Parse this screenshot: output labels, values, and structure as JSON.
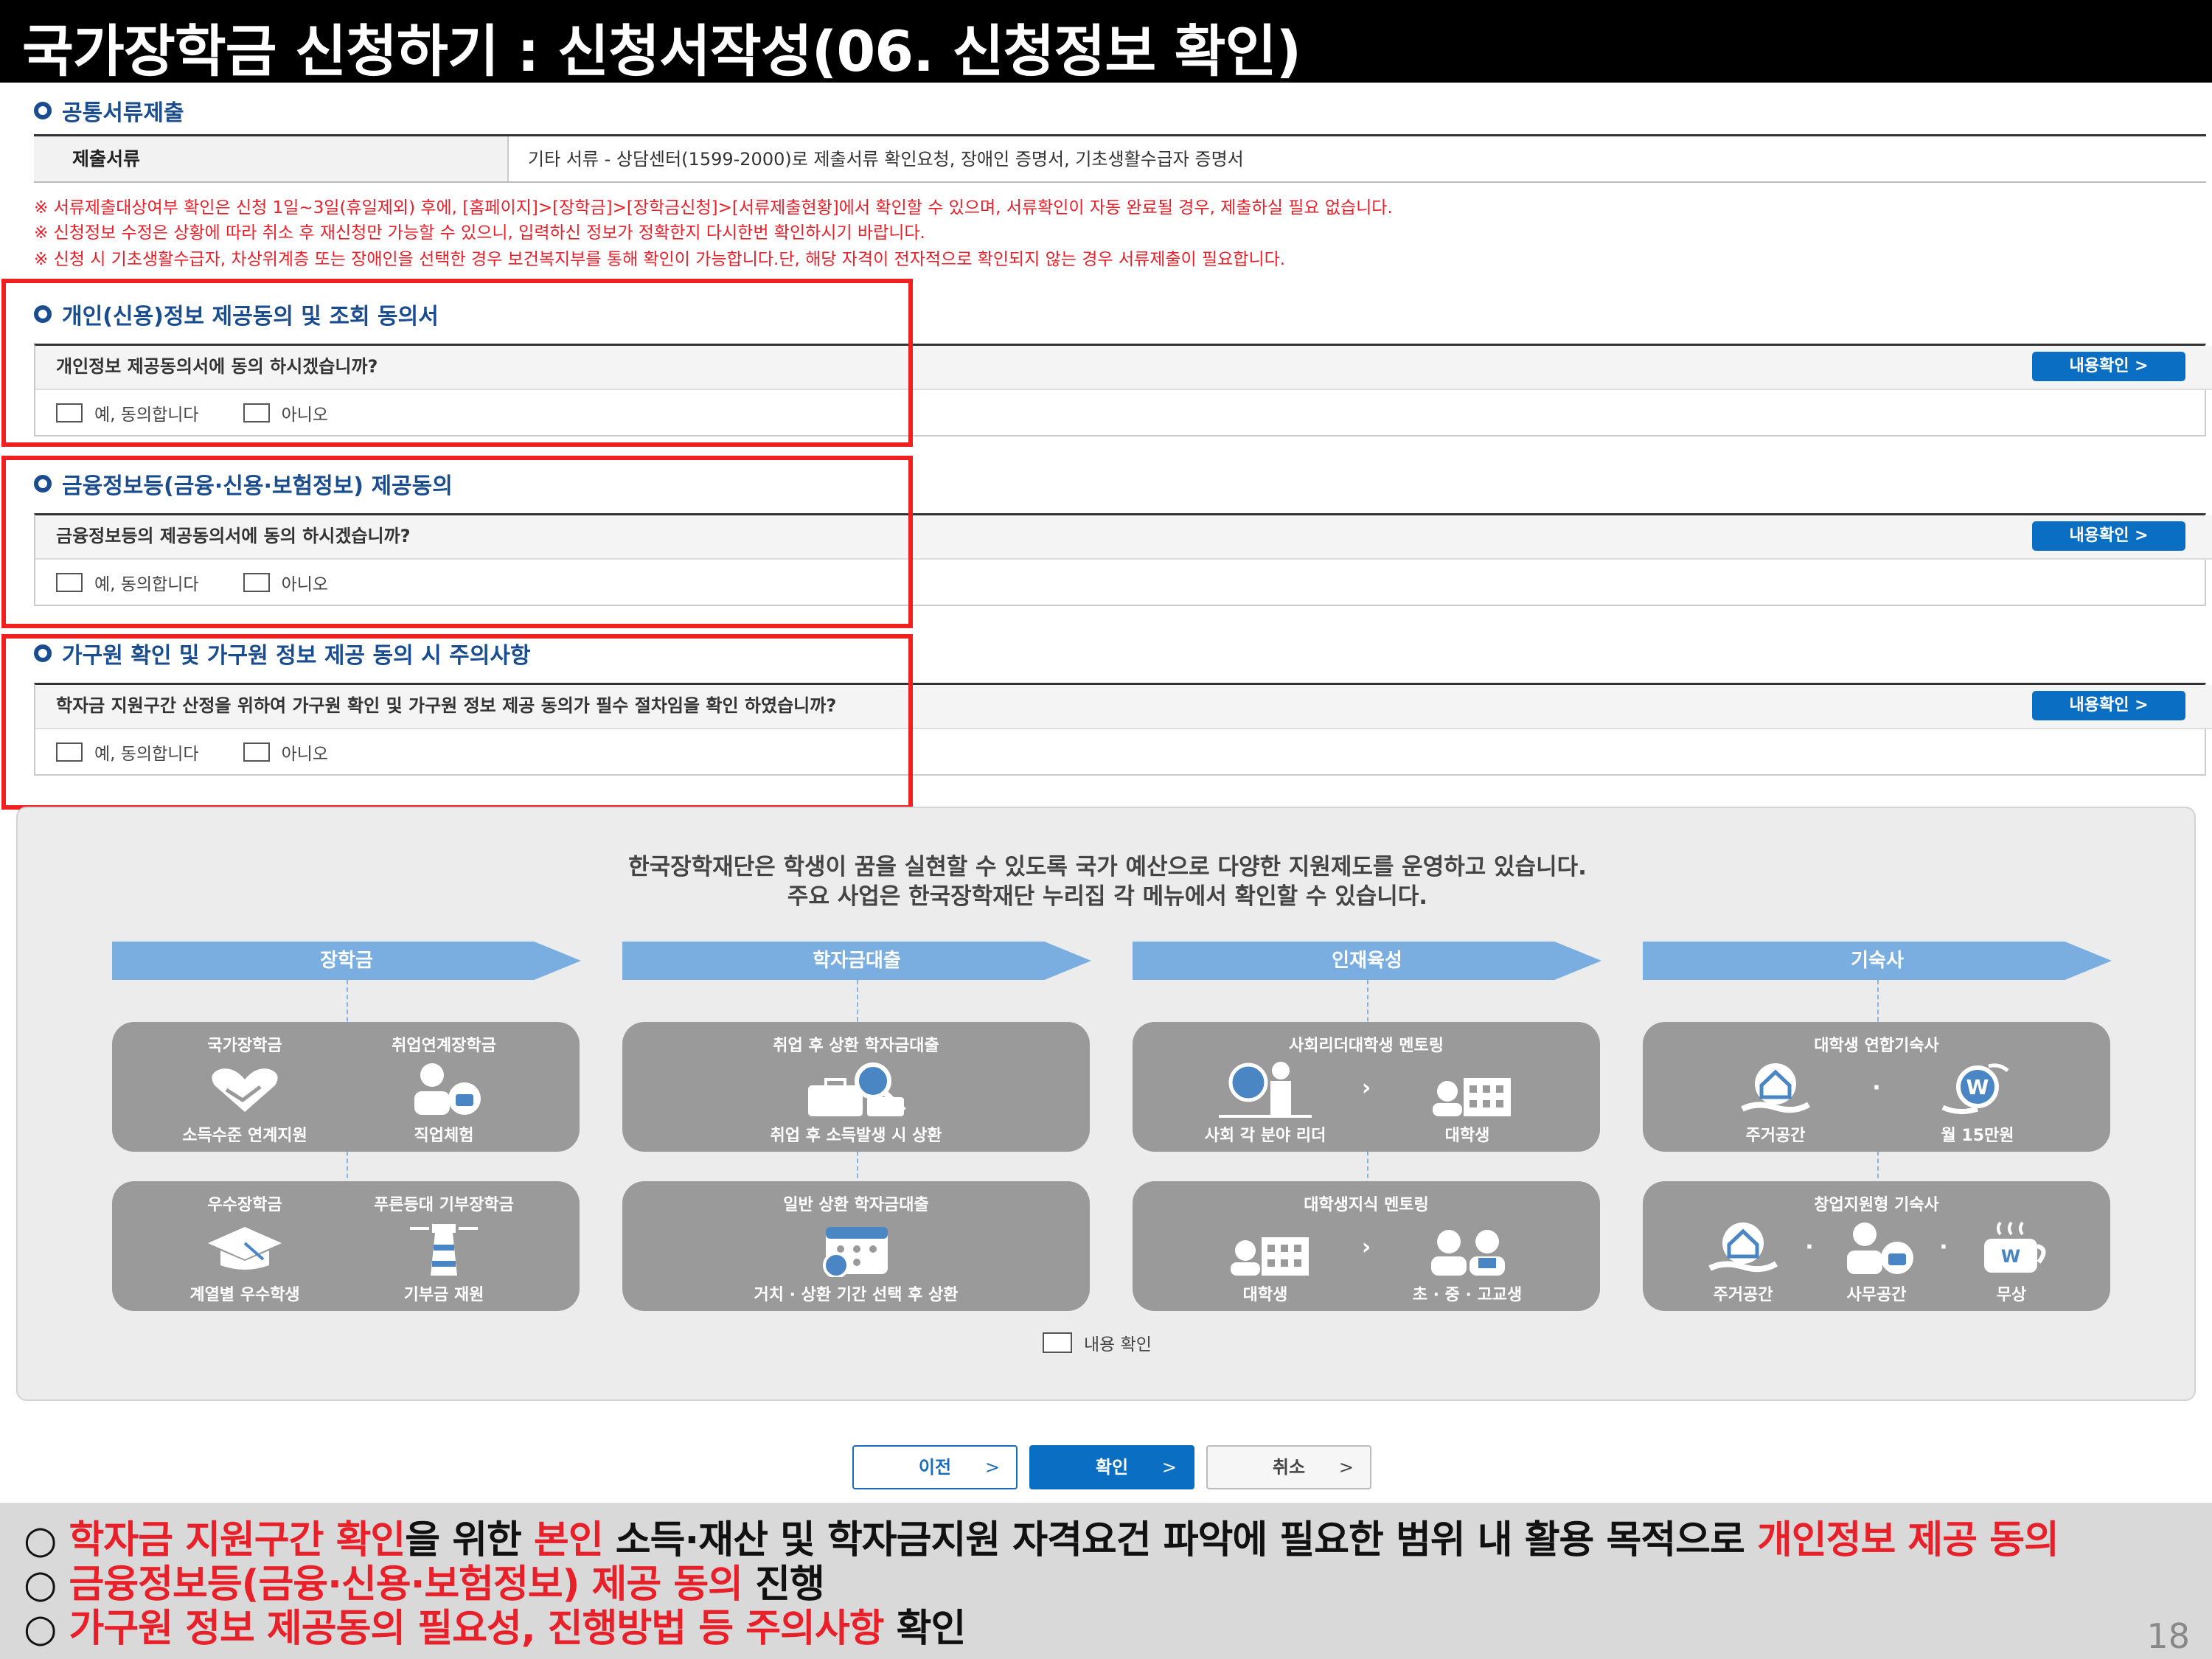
{
  "title": "국가장학금 신청하기 : 신청서작성(06. 신청정보 확인)",
  "docs": {
    "section_title": "공통서류제출",
    "header": "제출서류",
    "value": "기타 서류 - 상담센터(1599-2000)로 제출서류 확인요청, 장애인 증명서, 기초생활수급자 증명서"
  },
  "notices": [
    "※ 서류제출대상여부 확인은 신청 1일~3일(휴일제외) 후에, [홈페이지]>[장학금]>[장학금신청]>[서류제출현황]에서 확인할 수 있으며, 서류확인이 자동 완료될 경우, 제출하실 필요 없습니다.",
    "※ 신청정보 수정은 상황에 따라 취소 후 재신청만 가능할 수 있으니, 입력하신 정보가 정확한지 다시한번 확인하시기 바랍니다.",
    "※ 신청 시 기초생활수급자, 차상위계층 또는 장애인을 선택한 경우 보건복지부를 통해 확인이 가능합니다.단, 해당 자격이 전자적으로 확인되지 않는 경우 서류제출이 필요합니다."
  ],
  "consents": [
    {
      "title": "개인(신용)정보 제공동의 및 조회 동의서",
      "question": "개인정보 제공동의서에 동의 하시겠습니까?",
      "yes": "예, 동의합니다",
      "no": "아니오",
      "view": "내용확인"
    },
    {
      "title": "금융정보등(금융·신용·보험정보) 제공동의",
      "question": "금융정보등의 제공동의서에 동의 하시겠습니까?",
      "yes": "예, 동의합니다",
      "no": "아니오",
      "view": "내용확인"
    },
    {
      "title": "가구원 확인 및 가구원 정보 제공 동의 시 주의사항",
      "question": "학자금 지원구간 산정을 위하여 가구원 확인 및 가구원 정보 제공 동의가 필수 절차임을 확인 하였습니까?",
      "yes": "예, 동의합니다",
      "no": "아니오",
      "view": "내용확인"
    }
  ],
  "info": {
    "line1": "한국장학재단은 학생이 꿈을 실현할 수 있도록 국가 예산으로 다양한 지원제도를 운영하고 있습니다.",
    "line2": "주요 사업은 한국장학재단 누리집 각 메뉴에서 확인할 수 있습니다.",
    "categories": [
      "장학금",
      "학자금대출",
      "인재육성",
      "기숙사"
    ],
    "cards": {
      "c1a": {
        "t1": "국가장학금",
        "t2": "취업연계장학금",
        "b1": "소득수준 연계지원",
        "b2": "직업체험"
      },
      "c1b": {
        "t1": "우수장학금",
        "t2": "푸른등대 기부장학금",
        "b1": "계열별 우수학생",
        "b2": "기부금 재원"
      },
      "c2a": {
        "t": "취업 후 상환 학자금대출",
        "b": "취업 후 소득발생 시 상환"
      },
      "c2b": {
        "t": "일반 상환 학자금대출",
        "b": "거치 · 상환 기간 선택 후 상환"
      },
      "c3a": {
        "t": "사회리더대학생 멘토링",
        "b1": "사회 각 분야 리더",
        "b2": "대학생"
      },
      "c3b": {
        "t": "대학생지식 멘토링",
        "b1": "대학생",
        "b2": "초 · 중 · 고교생"
      },
      "c4a": {
        "t": "대학생 연합기숙사",
        "b1": "주거공간",
        "b2": "월 15만원"
      },
      "c4b": {
        "t": "창업지원형 기숙사",
        "b1": "주거공간",
        "b2": "사무공간",
        "b3": "무상"
      }
    },
    "check_label": "내용 확인"
  },
  "nav": {
    "prev": "이전",
    "confirm": "확인",
    "cancel": "취소"
  },
  "bottom": {
    "l1": [
      {
        "t": "○ ",
        "r": false
      },
      {
        "t": "학자금 지원구간 확인",
        "r": true
      },
      {
        "t": "을 위한 ",
        "r": false
      },
      {
        "t": "본인",
        "r": true
      },
      {
        "t": " 소득·재산 및 학자금지원 자격요건 파악에 필요한 범위 내 활용 목적으로 ",
        "r": false
      },
      {
        "t": "개인정보 제공 동의",
        "r": true
      }
    ],
    "l2": [
      {
        "t": "○ ",
        "r": false
      },
      {
        "t": "금융정보등(금융·신용·보험정보) 제공 동의",
        "r": true
      },
      {
        "t": " 진행",
        "r": false
      }
    ],
    "l3": [
      {
        "t": "○ ",
        "r": false
      },
      {
        "t": "가구원 정보 제공동의 필요성, 진행방법 등 주의사항",
        "r": true
      },
      {
        "t": " 확인",
        "r": false
      }
    ]
  },
  "page_number": "18",
  "colors": {
    "accent_blue": "#0a6fc2",
    "highlight_red": "#e8202a",
    "chevron_blue": "#7aaee0",
    "card_gray": "#9a9a9a"
  }
}
